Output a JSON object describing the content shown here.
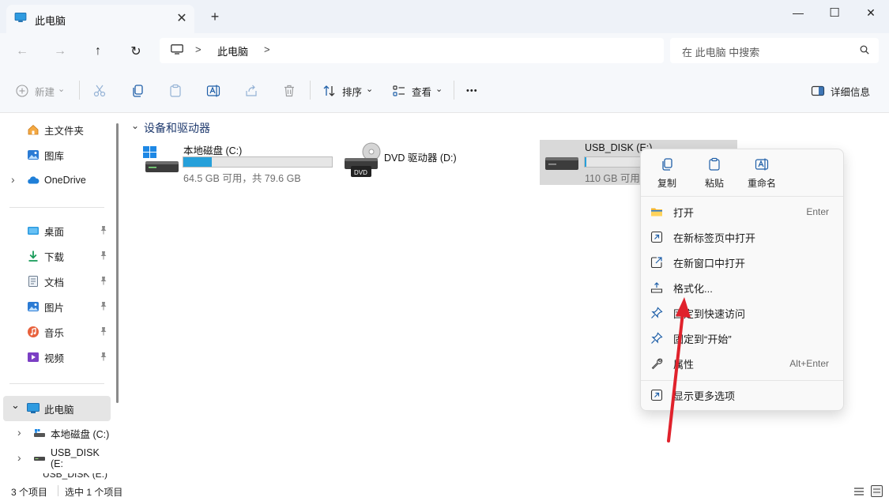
{
  "window": {
    "tab_title": "此电脑",
    "tab_close_symbol": "✕",
    "new_tab_symbol": "+",
    "minimize_symbol": "—",
    "maximize_symbol": "☐",
    "close_symbol": "✕"
  },
  "nav": {
    "back_symbol": "←",
    "forward_symbol": "→",
    "up_symbol": "↑",
    "refresh_symbol": "↻",
    "breadcrumb_separator": ">",
    "breadcrumb": [
      "此电脑"
    ],
    "search_placeholder": "在 此电脑 中搜索"
  },
  "toolbar": {
    "new_label": "新建",
    "sort_label": "排序",
    "view_label": "查看",
    "more_symbol": "•••",
    "details_label": "详细信息",
    "dropdown_symbol": "⌄"
  },
  "sidebar": {
    "pinned": [
      {
        "label": "主文件夹",
        "icon": "home-icon"
      },
      {
        "label": "图库",
        "icon": "gallery-icon"
      },
      {
        "label": "OneDrive",
        "icon": "onedrive-icon"
      }
    ],
    "quick_access": [
      {
        "label": "桌面",
        "icon": "desktop-icon"
      },
      {
        "label": "下载",
        "icon": "download-icon"
      },
      {
        "label": "文档",
        "icon": "document-icon"
      },
      {
        "label": "图片",
        "icon": "pictures-icon"
      },
      {
        "label": "音乐",
        "icon": "music-icon"
      },
      {
        "label": "视频",
        "icon": "video-icon"
      }
    ],
    "this_pc": {
      "label": "此电脑",
      "icon": "this-pc-icon"
    },
    "this_pc_children": [
      {
        "label": "本地磁盘 (C:)"
      },
      {
        "label": "USB_DISK (E:"
      },
      {
        "label": "USB_DISK (E:)"
      }
    ],
    "chevron_right": "›",
    "chevron_down": "⌄"
  },
  "content": {
    "section_title": "设备和驱动器",
    "section_chevron": "⌄",
    "drives": [
      {
        "name": "本地磁盘 (C:)",
        "info": "64.5 GB 可用，共 79.6 GB",
        "used_fraction": 0.19
      },
      {
        "name": "DVD 驱动器 (D:)",
        "badge": "DVD"
      },
      {
        "name": "USB_DISK (E:)",
        "info": "110 GB 可用",
        "used_fraction": 0.01
      }
    ]
  },
  "context_menu": {
    "top_actions": [
      {
        "label": "复制",
        "icon": "copy-icon"
      },
      {
        "label": "粘贴",
        "icon": "paste-icon"
      },
      {
        "label": "重命名",
        "icon": "rename-icon"
      }
    ],
    "items": [
      {
        "label": "打开",
        "shortcut": "Enter",
        "icon": "folder-open-icon"
      },
      {
        "label": "在新标签页中打开",
        "shortcut": "",
        "icon": "open-new-tab-icon"
      },
      {
        "label": "在新窗口中打开",
        "shortcut": "",
        "icon": "open-new-window-icon"
      },
      {
        "label": "格式化...",
        "shortcut": "",
        "icon": "format-icon"
      },
      {
        "label": "固定到快速访问",
        "shortcut": "",
        "icon": "pin-icon"
      },
      {
        "label": "固定到“开始”",
        "shortcut": "",
        "icon": "pin-icon"
      },
      {
        "label": "属性",
        "shortcut": "Alt+Enter",
        "icon": "wrench-icon"
      }
    ],
    "more_options": {
      "label": "显示更多选项",
      "icon": "more-options-icon"
    }
  },
  "status": {
    "item_count": "3 个项目",
    "selected": "选中 1 个项目"
  },
  "colors": {
    "accent": "#26a0da",
    "annotation_arrow": "#e0222c"
  }
}
